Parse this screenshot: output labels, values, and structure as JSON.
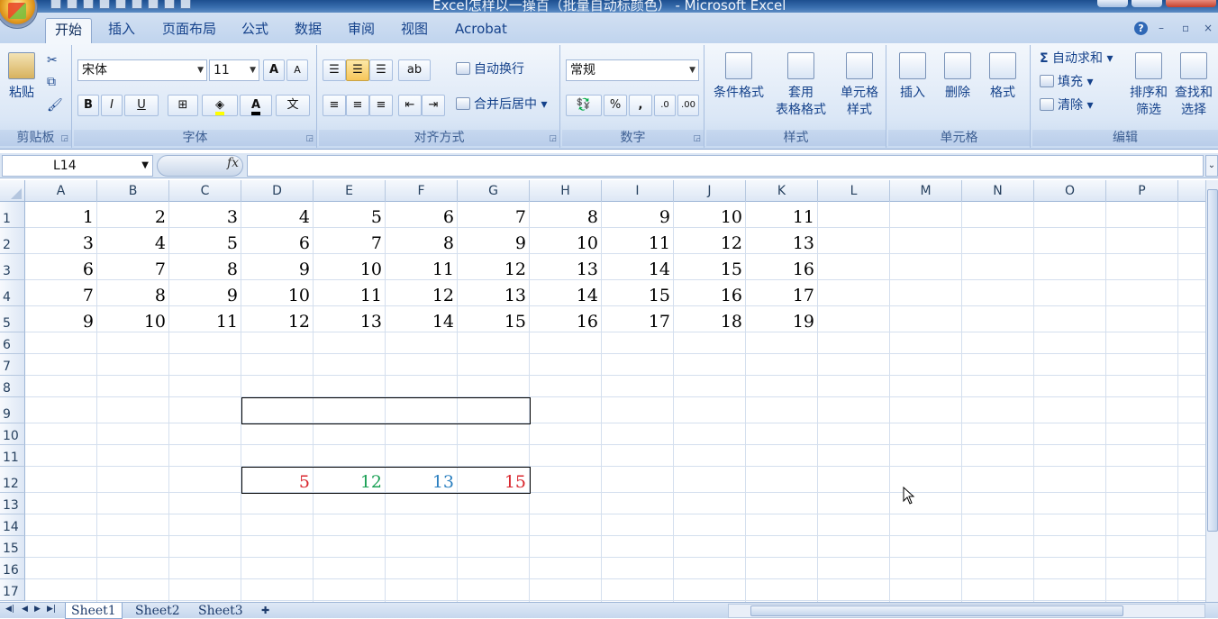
{
  "window": {
    "title": "Excel怎样以一操百（批量自动标颜色） - Microsoft Excel"
  },
  "tabs": [
    "开始",
    "插入",
    "页面布局",
    "公式",
    "数据",
    "审阅",
    "视图",
    "Acrobat"
  ],
  "ribbon": {
    "clipboard": {
      "label": "剪贴板",
      "paste": "粘贴"
    },
    "font": {
      "label": "字体",
      "name": "宋体",
      "size": "11",
      "bold": "B",
      "italic": "I",
      "underline": "U",
      "grow": "A",
      "shrink": "A"
    },
    "alignment": {
      "label": "对齐方式",
      "wrap": "自动换行",
      "merge": "合并后居中"
    },
    "number": {
      "label": "数字",
      "format": "常规",
      "percent": "%",
      "comma": ","
    },
    "styles": {
      "label": "样式",
      "conditional": "条件格式",
      "table1": "套用",
      "table2": "表格格式",
      "cell1": "单元格",
      "cell2": "样式"
    },
    "cells": {
      "label": "单元格",
      "insert": "插入",
      "delete": "删除",
      "format": "格式"
    },
    "editing": {
      "label": "编辑",
      "autosum": "自动求和",
      "fill": "填充",
      "clear": "清除",
      "sort1": "排序和",
      "sort2": "筛选",
      "find1": "查找和",
      "find2": "选择"
    }
  },
  "formula_bar": {
    "name_box": "L14",
    "fx": "fx",
    "formula": ""
  },
  "columns": [
    "A",
    "B",
    "C",
    "D",
    "E",
    "F",
    "G",
    "H",
    "I",
    "J",
    "K",
    "L",
    "M",
    "N",
    "O",
    "P"
  ],
  "rows": [
    "1",
    "2",
    "3",
    "4",
    "5",
    "6",
    "7",
    "8",
    "9",
    "10",
    "11",
    "12",
    "13",
    "14",
    "15",
    "16",
    "17"
  ],
  "data_rows": [
    [
      "1",
      "2",
      "3",
      "4",
      "5",
      "6",
      "7",
      "8",
      "9",
      "10",
      "11"
    ],
    [
      "3",
      "4",
      "5",
      "6",
      "7",
      "8",
      "9",
      "10",
      "11",
      "12",
      "13"
    ],
    [
      "6",
      "7",
      "8",
      "9",
      "10",
      "11",
      "12",
      "13",
      "14",
      "15",
      "16"
    ],
    [
      "7",
      "8",
      "9",
      "10",
      "11",
      "12",
      "13",
      "14",
      "15",
      "16",
      "17"
    ],
    [
      "9",
      "10",
      "11",
      "12",
      "13",
      "14",
      "15",
      "16",
      "17",
      "18",
      "19"
    ]
  ],
  "row12_cells": [
    {
      "col": "D",
      "value": "5",
      "color": "#d9262e"
    },
    {
      "col": "E",
      "value": "12",
      "color": "#1aa055"
    },
    {
      "col": "F",
      "value": "13",
      "color": "#2a7fc0"
    },
    {
      "col": "G",
      "value": "15",
      "color": "#d9262e"
    }
  ],
  "sheets": [
    "Sheet1",
    "Sheet2",
    "Sheet3"
  ],
  "active_sheet": "Sheet1"
}
